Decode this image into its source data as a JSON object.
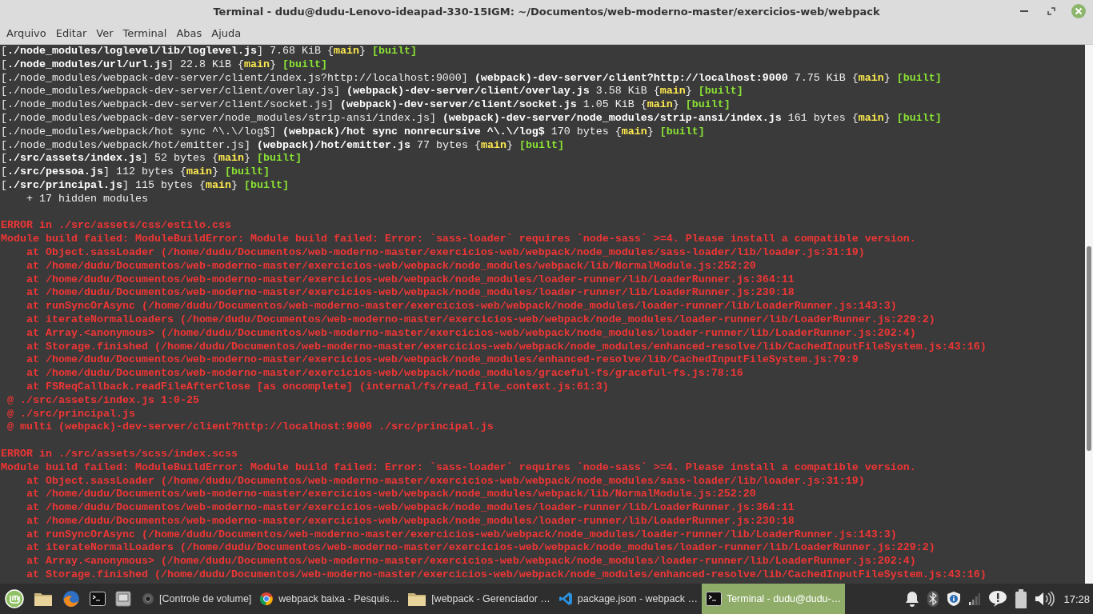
{
  "window": {
    "title": "Terminal - dudu@dudu-Lenovo-ideapad-330-15IGM: ~/Documentos/web-moderno-master/exercicios-web/webpack"
  },
  "menu": [
    "Arquivo",
    "Editar",
    "Ver",
    "Terminal",
    "Abas",
    "Ajuda"
  ],
  "terminal": {
    "lines": [
      {
        "kind": "text",
        "segments": [
          {
            "text": "[",
            "kind": "text"
          },
          {
            "text": "./node_modules/loglevel/lib/loglevel.js",
            "kind": "name"
          },
          {
            "text": "] 7.68 KiB {",
            "kind": "text"
          },
          {
            "text": "main",
            "kind": "chunk"
          },
          {
            "text": "} ",
            "kind": "text"
          },
          {
            "text": "[built]",
            "kind": "status"
          }
        ]
      },
      {
        "kind": "text",
        "segments": [
          {
            "text": "[",
            "kind": "text"
          },
          {
            "text": "./node_modules/url/url.js",
            "kind": "name"
          },
          {
            "text": "] 22.8 KiB {",
            "kind": "text"
          },
          {
            "text": "main",
            "kind": "chunk"
          },
          {
            "text": "} ",
            "kind": "text"
          },
          {
            "text": "[built]",
            "kind": "status"
          }
        ]
      },
      {
        "kind": "text",
        "segments": [
          {
            "text": "[./node_modules/webpack-dev-server/client/index.js?http://localhost:9000] ",
            "kind": "text"
          },
          {
            "text": "(webpack)-dev-server/client?http://localhost:9000",
            "kind": "name"
          },
          {
            "text": " 7.75 KiB {",
            "kind": "text"
          },
          {
            "text": "main",
            "kind": "chunk"
          },
          {
            "text": "} ",
            "kind": "text"
          },
          {
            "text": "[built]",
            "kind": "status"
          }
        ]
      },
      {
        "kind": "text",
        "segments": [
          {
            "text": "[./node_modules/webpack-dev-server/client/overlay.js] ",
            "kind": "text"
          },
          {
            "text": "(webpack)-dev-server/client/overlay.js",
            "kind": "name"
          },
          {
            "text": " 3.58 KiB {",
            "kind": "text"
          },
          {
            "text": "main",
            "kind": "chunk"
          },
          {
            "text": "} ",
            "kind": "text"
          },
          {
            "text": "[built]",
            "kind": "status"
          }
        ]
      },
      {
        "kind": "text",
        "segments": [
          {
            "text": "[./node_modules/webpack-dev-server/client/socket.js] ",
            "kind": "text"
          },
          {
            "text": "(webpack)-dev-server/client/socket.js",
            "kind": "name"
          },
          {
            "text": " 1.05 KiB {",
            "kind": "text"
          },
          {
            "text": "main",
            "kind": "chunk"
          },
          {
            "text": "} ",
            "kind": "text"
          },
          {
            "text": "[built]",
            "kind": "status"
          }
        ]
      },
      {
        "kind": "text",
        "segments": [
          {
            "text": "[./node_modules/webpack-dev-server/node_modules/strip-ansi/index.js] ",
            "kind": "text"
          },
          {
            "text": "(webpack)-dev-server/node_modules/strip-ansi/index.js",
            "kind": "name"
          },
          {
            "text": " 161 bytes {",
            "kind": "text"
          },
          {
            "text": "main",
            "kind": "chunk"
          },
          {
            "text": "} ",
            "kind": "text"
          },
          {
            "text": "[built]",
            "kind": "status"
          }
        ]
      },
      {
        "kind": "text",
        "segments": [
          {
            "text": "[./node_modules/webpack/hot sync ^\\.\\/log$] ",
            "kind": "text"
          },
          {
            "text": "(webpack)/hot sync nonrecursive ^\\.\\/log$",
            "kind": "name"
          },
          {
            "text": " 170 bytes {",
            "kind": "text"
          },
          {
            "text": "main",
            "kind": "chunk"
          },
          {
            "text": "} ",
            "kind": "text"
          },
          {
            "text": "[built]",
            "kind": "status"
          }
        ]
      },
      {
        "kind": "text",
        "segments": [
          {
            "text": "[./node_modules/webpack/hot/emitter.js] ",
            "kind": "text"
          },
          {
            "text": "(webpack)/hot/emitter.js",
            "kind": "name"
          },
          {
            "text": " 77 bytes {",
            "kind": "text"
          },
          {
            "text": "main",
            "kind": "chunk"
          },
          {
            "text": "} ",
            "kind": "text"
          },
          {
            "text": "[built]",
            "kind": "status"
          }
        ]
      },
      {
        "kind": "text",
        "segments": [
          {
            "text": "[",
            "kind": "text"
          },
          {
            "text": "./src/assets/index.js",
            "kind": "name"
          },
          {
            "text": "] 52 bytes {",
            "kind": "text"
          },
          {
            "text": "main",
            "kind": "chunk"
          },
          {
            "text": "} ",
            "kind": "text"
          },
          {
            "text": "[built]",
            "kind": "status"
          }
        ]
      },
      {
        "kind": "text",
        "segments": [
          {
            "text": "[",
            "kind": "text"
          },
          {
            "text": "./src/pessoa.js",
            "kind": "name"
          },
          {
            "text": "] 112 bytes {",
            "kind": "text"
          },
          {
            "text": "main",
            "kind": "chunk"
          },
          {
            "text": "} ",
            "kind": "text"
          },
          {
            "text": "[built]",
            "kind": "status"
          }
        ]
      },
      {
        "kind": "text",
        "segments": [
          {
            "text": "[",
            "kind": "text"
          },
          {
            "text": "./src/principal.js",
            "kind": "name"
          },
          {
            "text": "] 115 bytes {",
            "kind": "text"
          },
          {
            "text": "main",
            "kind": "chunk"
          },
          {
            "text": "} ",
            "kind": "text"
          },
          {
            "text": "[built]",
            "kind": "status"
          }
        ]
      },
      {
        "kind": "text",
        "segments": [
          {
            "text": "    + 17 hidden modules",
            "kind": "text"
          }
        ]
      },
      {
        "kind": "blank"
      },
      {
        "kind": "text",
        "segments": [
          {
            "text": "ERROR in ./src/assets/css/estilo.css",
            "kind": "error"
          }
        ]
      },
      {
        "kind": "text",
        "segments": [
          {
            "text": "Module build failed: ModuleBuildError: Module build failed: Error: `sass-loader` requires `node-sass` >=4. Please install a compatible version.",
            "kind": "error"
          }
        ]
      },
      {
        "kind": "text",
        "segments": [
          {
            "text": "    at Object.sassLoader (/home/dudu/Documentos/web-moderno-master/exercicios-web/webpack/node_modules/sass-loader/lib/loader.js:31:19)",
            "kind": "error"
          }
        ]
      },
      {
        "kind": "text",
        "segments": [
          {
            "text": "    at /home/dudu/Documentos/web-moderno-master/exercicios-web/webpack/node_modules/webpack/lib/NormalModule.js:252:20",
            "kind": "error"
          }
        ]
      },
      {
        "kind": "text",
        "segments": [
          {
            "text": "    at /home/dudu/Documentos/web-moderno-master/exercicios-web/webpack/node_modules/loader-runner/lib/LoaderRunner.js:364:11",
            "kind": "error"
          }
        ]
      },
      {
        "kind": "text",
        "segments": [
          {
            "text": "    at /home/dudu/Documentos/web-moderno-master/exercicios-web/webpack/node_modules/loader-runner/lib/LoaderRunner.js:230:18",
            "kind": "error"
          }
        ]
      },
      {
        "kind": "text",
        "segments": [
          {
            "text": "    at runSyncOrAsync (/home/dudu/Documentos/web-moderno-master/exercicios-web/webpack/node_modules/loader-runner/lib/LoaderRunner.js:143:3)",
            "kind": "error"
          }
        ]
      },
      {
        "kind": "text",
        "segments": [
          {
            "text": "    at iterateNormalLoaders (/home/dudu/Documentos/web-moderno-master/exercicios-web/webpack/node_modules/loader-runner/lib/LoaderRunner.js:229:2)",
            "kind": "error"
          }
        ]
      },
      {
        "kind": "text",
        "segments": [
          {
            "text": "    at Array.<anonymous> (/home/dudu/Documentos/web-moderno-master/exercicios-web/webpack/node_modules/loader-runner/lib/LoaderRunner.js:202:4)",
            "kind": "error"
          }
        ]
      },
      {
        "kind": "text",
        "segments": [
          {
            "text": "    at Storage.finished (/home/dudu/Documentos/web-moderno-master/exercicios-web/webpack/node_modules/enhanced-resolve/lib/CachedInputFileSystem.js:43:16)",
            "kind": "error"
          }
        ]
      },
      {
        "kind": "text",
        "segments": [
          {
            "text": "    at /home/dudu/Documentos/web-moderno-master/exercicios-web/webpack/node_modules/enhanced-resolve/lib/CachedInputFileSystem.js:79:9",
            "kind": "error"
          }
        ]
      },
      {
        "kind": "text",
        "segments": [
          {
            "text": "    at /home/dudu/Documentos/web-moderno-master/exercicios-web/webpack/node_modules/graceful-fs/graceful-fs.js:78:16",
            "kind": "error"
          }
        ]
      },
      {
        "kind": "text",
        "segments": [
          {
            "text": "    at FSReqCallback.readFileAfterClose [as oncomplete] (internal/fs/read_file_context.js:61:3)",
            "kind": "error"
          }
        ]
      },
      {
        "kind": "text",
        "segments": [
          {
            "text": " @ ./src/assets/index.js 1:0-25",
            "kind": "error"
          }
        ]
      },
      {
        "kind": "text",
        "segments": [
          {
            "text": " @ ./src/principal.js",
            "kind": "error"
          }
        ]
      },
      {
        "kind": "text",
        "segments": [
          {
            "text": " @ multi (webpack)-dev-server/client?http://localhost:9000 ./src/principal.js",
            "kind": "error"
          }
        ]
      },
      {
        "kind": "blank"
      },
      {
        "kind": "text",
        "segments": [
          {
            "text": "ERROR in ./src/assets/scss/index.scss",
            "kind": "error"
          }
        ]
      },
      {
        "kind": "text",
        "segments": [
          {
            "text": "Module build failed: ModuleBuildError: Module build failed: Error: `sass-loader` requires `node-sass` >=4. Please install a compatible version.",
            "kind": "error"
          }
        ]
      },
      {
        "kind": "text",
        "segments": [
          {
            "text": "    at Object.sassLoader (/home/dudu/Documentos/web-moderno-master/exercicios-web/webpack/node_modules/sass-loader/lib/loader.js:31:19)",
            "kind": "error"
          }
        ]
      },
      {
        "kind": "text",
        "segments": [
          {
            "text": "    at /home/dudu/Documentos/web-moderno-master/exercicios-web/webpack/node_modules/webpack/lib/NormalModule.js:252:20",
            "kind": "error"
          }
        ]
      },
      {
        "kind": "text",
        "segments": [
          {
            "text": "    at /home/dudu/Documentos/web-moderno-master/exercicios-web/webpack/node_modules/loader-runner/lib/LoaderRunner.js:364:11",
            "kind": "error"
          }
        ]
      },
      {
        "kind": "text",
        "segments": [
          {
            "text": "    at /home/dudu/Documentos/web-moderno-master/exercicios-web/webpack/node_modules/loader-runner/lib/LoaderRunner.js:230:18",
            "kind": "error"
          }
        ]
      },
      {
        "kind": "text",
        "segments": [
          {
            "text": "    at runSyncOrAsync (/home/dudu/Documentos/web-moderno-master/exercicios-web/webpack/node_modules/loader-runner/lib/LoaderRunner.js:143:3)",
            "kind": "error"
          }
        ]
      },
      {
        "kind": "text",
        "segments": [
          {
            "text": "    at iterateNormalLoaders (/home/dudu/Documentos/web-moderno-master/exercicios-web/webpack/node_modules/loader-runner/lib/LoaderRunner.js:229:2)",
            "kind": "error"
          }
        ]
      },
      {
        "kind": "text",
        "segments": [
          {
            "text": "    at Array.<anonymous> (/home/dudu/Documentos/web-moderno-master/exercicios-web/webpack/node_modules/loader-runner/lib/LoaderRunner.js:202:4)",
            "kind": "error"
          }
        ]
      },
      {
        "kind": "text",
        "segments": [
          {
            "text": "    at Storage.finished (/home/dudu/Documentos/web-moderno-master/exercicios-web/webpack/node_modules/enhanced-resolve/lib/CachedInputFileSystem.js:43:16)",
            "kind": "error"
          }
        ]
      }
    ]
  },
  "taskbar": {
    "launchers": [
      {
        "kind": "mint"
      },
      {
        "kind": "folder"
      },
      {
        "kind": "firefox"
      },
      {
        "kind": "terminal"
      },
      {
        "kind": "monitor"
      }
    ],
    "windows": [
      {
        "kind": "speaker",
        "label": "[Controle de volume]",
        "selected": false
      },
      {
        "kind": "chrome",
        "label": "webpack baixa - Pesquis…",
        "selected": false
      },
      {
        "kind": "folder",
        "label": "[webpack - Gerenciador …",
        "selected": false
      },
      {
        "kind": "vscode",
        "label": "package.json - webpack …",
        "selected": false
      },
      {
        "kind": "terminal",
        "label": "Terminal - dudu@dudu-…",
        "selected": true
      }
    ],
    "tray": [
      {
        "kind": "bell"
      },
      {
        "kind": "bluetooth"
      },
      {
        "kind": "shield"
      },
      {
        "kind": "signal"
      },
      {
        "kind": "alert"
      },
      {
        "kind": "battery"
      },
      {
        "kind": "volume"
      }
    ],
    "clock": "17:28"
  }
}
